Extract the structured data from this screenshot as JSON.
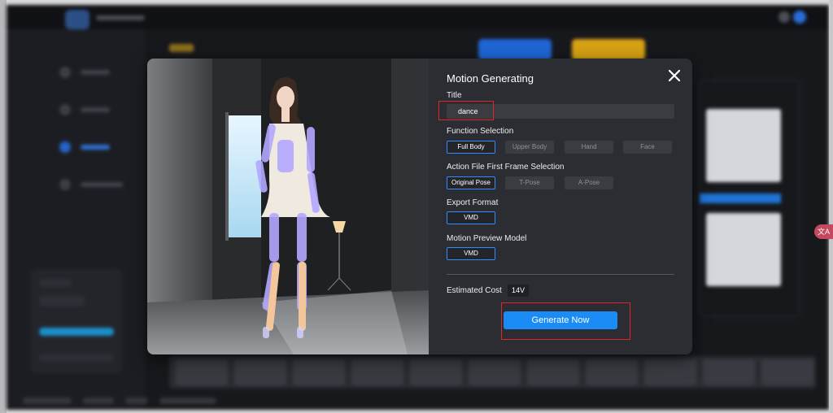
{
  "modal": {
    "title": "Motion Generating",
    "title_field": {
      "label": "Title",
      "value": "dance"
    },
    "function_selection": {
      "label": "Function Selection",
      "options": [
        "Full Body",
        "Upper Body",
        "Hand",
        "Face"
      ],
      "selected": "Full Body"
    },
    "first_frame_selection": {
      "label": "Action File First Frame Selection",
      "options": [
        "Original Pose",
        "T-Pose",
        "A-Pose"
      ],
      "selected": "Original Pose"
    },
    "export_format": {
      "label": "Export Format",
      "options": [
        "VMD"
      ],
      "selected": "VMD"
    },
    "preview_model": {
      "label": "Motion Preview Model",
      "options": [
        "VMD"
      ],
      "selected": "VMD"
    },
    "estimated_cost": {
      "label": "Estimated Cost",
      "value": "14V"
    },
    "generate_button": "Generate Now"
  },
  "edge_badge": "文A",
  "colors": {
    "accent_blue": "#1b8cf5",
    "selected_border": "#2f8cff",
    "highlight_red": "#e02626",
    "modal_bg": "#2b2d32"
  }
}
